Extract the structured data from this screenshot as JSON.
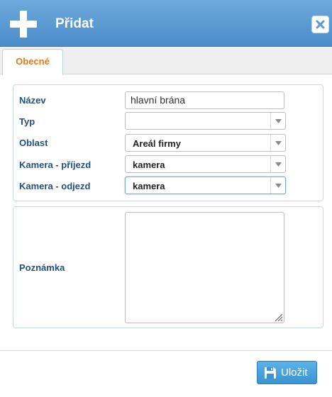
{
  "dialog": {
    "title": "Přidat",
    "close_icon": "close-icon",
    "add_icon": "plus-icon"
  },
  "tabs": [
    {
      "label": "Obecné",
      "active": true
    }
  ],
  "form": {
    "nazev": {
      "label": "Název",
      "value": "hlavní brána"
    },
    "typ": {
      "label": "Typ",
      "value": ""
    },
    "oblast": {
      "label": "Oblast",
      "value": "Areál firmy"
    },
    "kamera_prijezd": {
      "label": "Kamera - příjezd",
      "value": "kamera"
    },
    "kamera_odjezd": {
      "label": "Kamera - odjezd",
      "value": "kamera"
    },
    "poznamka": {
      "label": "Poznámka",
      "value": ""
    }
  },
  "footer": {
    "save_label": "Uložit",
    "save_icon": "floppy-disk-icon"
  },
  "colors": {
    "titlebar": "#5b9bd5",
    "tab_active_text": "#e07b1a",
    "label_text": "#25507d",
    "save_button": "#3b93d3"
  }
}
